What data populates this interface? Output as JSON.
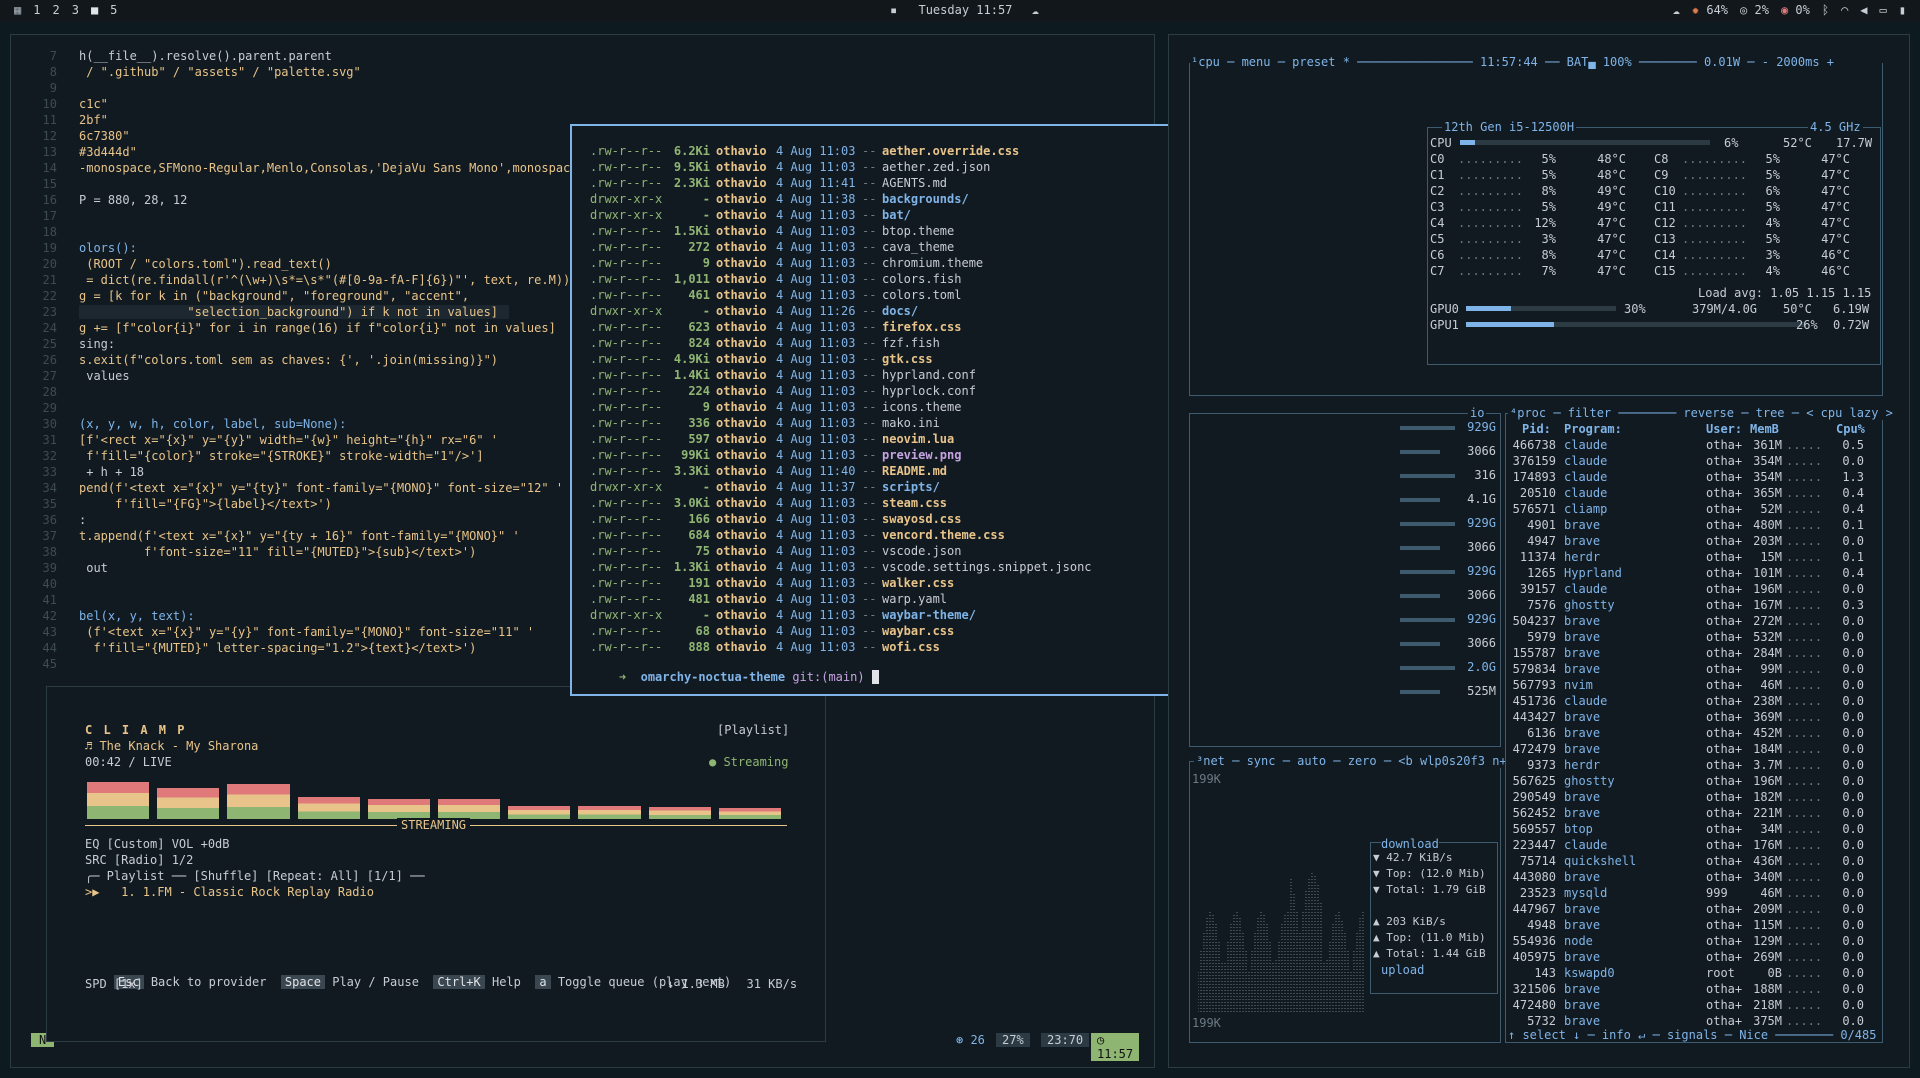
{
  "topbar": {
    "workspaces": [
      "1",
      "2",
      "3",
      "4",
      "5"
    ],
    "clock": "Tuesday 11:57",
    "cpu": "64%",
    "mem": "2%",
    "temp": "0%"
  },
  "editor": {
    "lines": [
      {
        "n": "7",
        "t": "h(__file__).resolve().parent.parent"
      },
      {
        "n": "8",
        "t": " / \".github\" / \"assets\" / \"palette.svg\""
      },
      {
        "n": "9",
        "t": ""
      },
      {
        "n": "10",
        "t": "c1c\""
      },
      {
        "n": "11",
        "t": "2bf\""
      },
      {
        "n": "12",
        "t": "6c7380\""
      },
      {
        "n": "13",
        "t": "#3d444d\""
      },
      {
        "n": "14",
        "t": "-monospace,SFMono-Regular,Menlo,Consolas,'DejaVu Sans Mono',monospace\""
      },
      {
        "n": "15",
        "t": ""
      },
      {
        "n": "16",
        "t": "P = 880, 28, 12"
      },
      {
        "n": "17",
        "t": ""
      },
      {
        "n": "18",
        "t": ""
      },
      {
        "n": "19",
        "t": "olors():"
      },
      {
        "n": "20",
        "t": " (ROOT / \"colors.toml\").read_text()"
      },
      {
        "n": "21",
        "t": " = dict(re.findall(r'^(\\w+)\\s*=\\s*\"(#[0-9a-fA-F]{6})\"', text, re.M))"
      },
      {
        "n": "22",
        "t": "g = [k for k in (\"background\", \"foreground\", \"accent\","
      },
      {
        "n": "23",
        "t": "               \"selection_background\") if k not in values]"
      },
      {
        "n": "24",
        "t": "g += [f\"color{i}\" for i in range(16) if f\"color{i}\" not in values]"
      },
      {
        "n": "25",
        "t": "sing:"
      },
      {
        "n": "26",
        "t": "s.exit(f\"colors.toml sem as chaves: {', '.join(missing)}\")"
      },
      {
        "n": "27",
        "t": " values"
      },
      {
        "n": "28",
        "t": ""
      },
      {
        "n": "29",
        "t": ""
      },
      {
        "n": "30",
        "t": "(x, y, w, h, color, label, sub=None):"
      },
      {
        "n": "31",
        "t": "[f'<rect x=\"{x}\" y=\"{y}\" width=\"{w}\" height=\"{h}\" rx=\"6\" '"
      },
      {
        "n": "32",
        "t": " f'fill=\"{color}\" stroke=\"{STROKE}\" stroke-width=\"1\"/>']"
      },
      {
        "n": "33",
        "t": " + h + 18"
      },
      {
        "n": "34",
        "t": "pend(f'<text x=\"{x}\" y=\"{ty}\" font-family=\"{MONO}\" font-size=\"12\" '"
      },
      {
        "n": "35",
        "t": "     f'fill=\"{FG}\">{label}</text>')"
      },
      {
        "n": "36",
        "t": ":"
      },
      {
        "n": "37",
        "t": "t.append(f'<text x=\"{x}\" y=\"{ty + 16}\" font-family=\"{MONO}\" '"
      },
      {
        "n": "38",
        "t": "         f'font-size=\"11\" fill=\"{MUTED}\">{sub}</text>')"
      },
      {
        "n": "39",
        "t": " out"
      },
      {
        "n": "40",
        "t": ""
      },
      {
        "n": "41",
        "t": ""
      },
      {
        "n": "42",
        "t": "bel(x, y, text):"
      },
      {
        "n": "43",
        "t": " (f'<text x=\"{x}\" y=\"{y}\" font-family=\"{MONO}\" font-size=\"11\" '"
      },
      {
        "n": "44",
        "t": "  f'fill=\"{MUTED}\" letter-spacing=\"1.2\">{text}</text>')"
      },
      {
        "n": "45",
        "t": ""
      }
    ],
    "status": {
      "mode": "N",
      "branch": "26",
      "pct": "27%",
      "pos": "23:70",
      "time": "11:57"
    }
  },
  "listing": {
    "entries": [
      {
        "p": ".rw-r--r--",
        "s": "6.2Ki",
        "u": "othavio",
        "d": "4 Aug 11:03",
        "n": "aether.override.css",
        "c": "yl"
      },
      {
        "p": ".rw-r--r--",
        "s": "9.5Ki",
        "u": "othavio",
        "d": "4 Aug 11:03",
        "n": "aether.zed.json",
        "c": ""
      },
      {
        "p": ".rw-r--r--",
        "s": "2.3Ki",
        "u": "othavio",
        "d": "4 Aug 11:41",
        "n": "AGENTS.md",
        "c": ""
      },
      {
        "p": "drwxr-xr-x",
        "s": "-",
        "u": "othavio",
        "d": "4 Aug 11:38",
        "n": "backgrounds/",
        "c": "bl"
      },
      {
        "p": "drwxr-xr-x",
        "s": "-",
        "u": "othavio",
        "d": "4 Aug 11:03",
        "n": "bat/",
        "c": "bl"
      },
      {
        "p": ".rw-r--r--",
        "s": "1.5Ki",
        "u": "othavio",
        "d": "4 Aug 11:03",
        "n": "btop.theme",
        "c": ""
      },
      {
        "p": ".rw-r--r--",
        "s": "272",
        "u": "othavio",
        "d": "4 Aug 11:03",
        "n": "cava_theme",
        "c": ""
      },
      {
        "p": ".rw-r--r--",
        "s": "9",
        "u": "othavio",
        "d": "4 Aug 11:03",
        "n": "chromium.theme",
        "c": ""
      },
      {
        "p": ".rw-r--r--",
        "s": "1,011",
        "u": "othavio",
        "d": "4 Aug 11:03",
        "n": "colors.fish",
        "c": ""
      },
      {
        "p": ".rw-r--r--",
        "s": "461",
        "u": "othavio",
        "d": "4 Aug 11:03",
        "n": "colors.toml",
        "c": ""
      },
      {
        "p": "drwxr-xr-x",
        "s": "-",
        "u": "othavio",
        "d": "4 Aug 11:26",
        "n": "docs/",
        "c": "bl"
      },
      {
        "p": ".rw-r--r--",
        "s": "623",
        "u": "othavio",
        "d": "4 Aug 11:03",
        "n": "firefox.css",
        "c": "yl"
      },
      {
        "p": ".rw-r--r--",
        "s": "824",
        "u": "othavio",
        "d": "4 Aug 11:03",
        "n": "fzf.fish",
        "c": ""
      },
      {
        "p": ".rw-r--r--",
        "s": "4.9Ki",
        "u": "othavio",
        "d": "4 Aug 11:03",
        "n": "gtk.css",
        "c": "yl"
      },
      {
        "p": ".rw-r--r--",
        "s": "1.4Ki",
        "u": "othavio",
        "d": "4 Aug 11:03",
        "n": "hyprland.conf",
        "c": ""
      },
      {
        "p": ".rw-r--r--",
        "s": "224",
        "u": "othavio",
        "d": "4 Aug 11:03",
        "n": "hyprlock.conf",
        "c": ""
      },
      {
        "p": ".rw-r--r--",
        "s": "9",
        "u": "othavio",
        "d": "4 Aug 11:03",
        "n": "icons.theme",
        "c": ""
      },
      {
        "p": ".rw-r--r--",
        "s": "336",
        "u": "othavio",
        "d": "4 Aug 11:03",
        "n": "mako.ini",
        "c": ""
      },
      {
        "p": ".rw-r--r--",
        "s": "597",
        "u": "othavio",
        "d": "4 Aug 11:03",
        "n": "neovim.lua",
        "c": "yl"
      },
      {
        "p": ".rw-r--r--",
        "s": "99Ki",
        "u": "othavio",
        "d": "4 Aug 11:03",
        "n": "preview.png",
        "c": "kw"
      },
      {
        "p": ".rw-r--r--",
        "s": "3.3Ki",
        "u": "othavio",
        "d": "4 Aug 11:40",
        "n": "README.md",
        "c": "yl"
      },
      {
        "p": "drwxr-xr-x",
        "s": "-",
        "u": "othavio",
        "d": "4 Aug 11:37",
        "n": "scripts/",
        "c": "bl"
      },
      {
        "p": ".rw-r--r--",
        "s": "3.0Ki",
        "u": "othavio",
        "d": "4 Aug 11:03",
        "n": "steam.css",
        "c": "yl"
      },
      {
        "p": ".rw-r--r--",
        "s": "166",
        "u": "othavio",
        "d": "4 Aug 11:03",
        "n": "swayosd.css",
        "c": "yl"
      },
      {
        "p": ".rw-r--r--",
        "s": "684",
        "u": "othavio",
        "d": "4 Aug 11:03",
        "n": "vencord.theme.css",
        "c": "yl"
      },
      {
        "p": ".rw-r--r--",
        "s": "75",
        "u": "othavio",
        "d": "4 Aug 11:03",
        "n": "vscode.json",
        "c": ""
      },
      {
        "p": ".rw-r--r--",
        "s": "1.3Ki",
        "u": "othavio",
        "d": "4 Aug 11:03",
        "n": "vscode.settings.snippet.jsonc",
        "c": ""
      },
      {
        "p": ".rw-r--r--",
        "s": "191",
        "u": "othavio",
        "d": "4 Aug 11:03",
        "n": "walker.css",
        "c": "yl"
      },
      {
        "p": ".rw-r--r--",
        "s": "481",
        "u": "othavio",
        "d": "4 Aug 11:03",
        "n": "warp.yaml",
        "c": ""
      },
      {
        "p": "drwxr-xr-x",
        "s": "-",
        "u": "othavio",
        "d": "4 Aug 11:03",
        "n": "waybar-theme/",
        "c": "bl"
      },
      {
        "p": ".rw-r--r--",
        "s": "68",
        "u": "othavio",
        "d": "4 Aug 11:03",
        "n": "waybar.css",
        "c": "yl"
      },
      {
        "p": ".rw-r--r--",
        "s": "888",
        "u": "othavio",
        "d": "4 Aug 11:03",
        "n": "wofi.css",
        "c": "yl"
      }
    ],
    "prompt_dir": "omarchy-noctua-theme",
    "prompt_git": "git:(main)"
  },
  "player": {
    "title": "C L I A M P",
    "mode": "[Playlist]",
    "track": "♬ The Knack - My Sharona",
    "time": "00:42 / LIVE",
    "status": "● Streaming",
    "bars": [
      0.85,
      0.7,
      0.8,
      0.5,
      0.45,
      0.45,
      0.3,
      0.3,
      0.28,
      0.25
    ],
    "streaming_label": "STREAMING",
    "eq": "EQ [Custom] VOL +0dB",
    "src": "SRC [Radio] 1/2",
    "playlist_header": "╭─ Playlist ── [Shuffle] [Repeat: All] [1/1] ──",
    "playlist_item": ">▶   1. 1.FM - Classic Rock Replay Radio",
    "keys": [
      {
        "k": "Esc",
        "l": "Back to provider"
      },
      {
        "k": "Space",
        "l": "Play / Pause"
      },
      {
        "k": "Ctrl+K",
        "l": "Help"
      },
      {
        "k": "a",
        "l": "Toggle queue (play next)"
      }
    ],
    "spd": "SPD [1x]",
    "dl": "↓ 1.3 MB   31 KB/s"
  },
  "btop": {
    "header": "¹cpu ─ menu ─ preset * ──────────────── 11:57:44 ── BAT▄ 100% ──────── 0.01W ─ - 2000ms +",
    "cpu_model": "12th Gen i5-12500H",
    "cpu_freq": "4.5 GHz",
    "cpu_total": {
      "label": "CPU",
      "pct": "6%",
      "temp": "52°C",
      "pow": "17.7W",
      "val": 0.06
    },
    "cores": [
      {
        "l": "C0",
        "p": "5%",
        "t": "48°C"
      },
      {
        "l": "C8",
        "p": "5%",
        "t": "47°C"
      },
      {
        "l": "C1",
        "p": "5%",
        "t": "48°C"
      },
      {
        "l": "C9",
        "p": "5%",
        "t": "47°C"
      },
      {
        "l": "C2",
        "p": "8%",
        "t": "49°C"
      },
      {
        "l": "C10",
        "p": "6%",
        "t": "47°C"
      },
      {
        "l": "C3",
        "p": "5%",
        "t": "49°C"
      },
      {
        "l": "C11",
        "p": "5%",
        "t": "47°C"
      },
      {
        "l": "C4",
        "p": "12%",
        "t": "47°C"
      },
      {
        "l": "C12",
        "p": "4%",
        "t": "47°C"
      },
      {
        "l": "C5",
        "p": "3%",
        "t": "47°C"
      },
      {
        "l": "C13",
        "p": "5%",
        "t": "47°C"
      },
      {
        "l": "C6",
        "p": "8%",
        "t": "47°C"
      },
      {
        "l": "C14",
        "p": "3%",
        "t": "46°C"
      },
      {
        "l": "C7",
        "p": "7%",
        "t": "47°C"
      },
      {
        "l": "C15",
        "p": "4%",
        "t": "46°C"
      }
    ],
    "load": "Load avg: 1.05 1.15 1.15",
    "gpu0": {
      "l": "GPU0",
      "p": "30%",
      "mem": "379M/4.0G",
      "t": "50°C",
      "w": "6.19W",
      "val": 0.3
    },
    "gpu1": {
      "l": "GPU1",
      "p": "26%",
      "w": "0.72W",
      "val": 0.26
    },
    "io_label": "io",
    "io_vals": [
      "929G",
      "3066",
      "316",
      "4.1G",
      "929G",
      "3066",
      "929G",
      "3066",
      "929G",
      "3066",
      "2.0G",
      "525M"
    ],
    "net_header": "³net ─ sync ─ auto ─ zero ─ <b wlp0s20f3 n+",
    "net_top": "199K",
    "net_bottom": "199K",
    "download": {
      "label": "download",
      "rate": "▼ 42.7 KiB/s",
      "top": "▼ Top: (12.0 Mib)",
      "total": "▼ Total: 1.79 GiB"
    },
    "upload": {
      "label": "upload",
      "rate": "▲ 203 KiB/s",
      "top": "▲ Top: (11.0 Mib)",
      "total": "▲ Total: 1.44 GiB"
    },
    "proc_header": "⁴proc ─ filter ──────── reverse ─ tree ─ < cpu lazy >",
    "proc_cols": {
      "pid": "Pid:",
      "prog": "Program:",
      "user": "User:",
      "mem": "MemB",
      "cpu": "Cpu%"
    },
    "procs": [
      [
        "466738",
        "claude",
        "otha+",
        "361M",
        "0.5"
      ],
      [
        "376159",
        "claude",
        "otha+",
        "354M",
        "0.0"
      ],
      [
        "174893",
        "claude",
        "otha+",
        "354M",
        "1.3"
      ],
      [
        "20510",
        "claude",
        "otha+",
        "365M",
        "0.4"
      ],
      [
        "576571",
        "cliamp",
        "otha+",
        "52M",
        "0.4"
      ],
      [
        "4901",
        "brave",
        "otha+",
        "480M",
        "0.1"
      ],
      [
        "4947",
        "brave",
        "otha+",
        "203M",
        "0.0"
      ],
      [
        "11374",
        "herdr",
        "otha+",
        "15M",
        "0.1"
      ],
      [
        "1265",
        "Hyprland",
        "otha+",
        "101M",
        "0.4"
      ],
      [
        "39157",
        "claude",
        "otha+",
        "196M",
        "0.0"
      ],
      [
        "7576",
        "ghostty",
        "otha+",
        "167M",
        "0.3"
      ],
      [
        "504237",
        "brave",
        "otha+",
        "272M",
        "0.0"
      ],
      [
        "5979",
        "brave",
        "otha+",
        "532M",
        "0.0"
      ],
      [
        "155787",
        "brave",
        "otha+",
        "284M",
        "0.0"
      ],
      [
        "579834",
        "brave",
        "otha+",
        "99M",
        "0.0"
      ],
      [
        "567793",
        "nvim",
        "otha+",
        "46M",
        "0.0"
      ],
      [
        "451736",
        "claude",
        "otha+",
        "238M",
        "0.0"
      ],
      [
        "443427",
        "brave",
        "otha+",
        "369M",
        "0.0"
      ],
      [
        "6136",
        "brave",
        "otha+",
        "452M",
        "0.0"
      ],
      [
        "472479",
        "brave",
        "otha+",
        "184M",
        "0.0"
      ],
      [
        "9373",
        "herdr",
        "otha+",
        "3.7M",
        "0.0"
      ],
      [
        "567625",
        "ghostty",
        "otha+",
        "196M",
        "0.0"
      ],
      [
        "290549",
        "brave",
        "otha+",
        "182M",
        "0.0"
      ],
      [
        "562452",
        "brave",
        "otha+",
        "221M",
        "0.0"
      ],
      [
        "569557",
        "btop",
        "otha+",
        "34M",
        "0.0"
      ],
      [
        "223447",
        "claude",
        "otha+",
        "176M",
        "0.0"
      ],
      [
        "75714",
        "quickshell",
        "otha+",
        "436M",
        "0.0"
      ],
      [
        "443080",
        "brave",
        "otha+",
        "340M",
        "0.0"
      ],
      [
        "23523",
        "mysqld",
        "999",
        "46M",
        "0.0"
      ],
      [
        "447967",
        "brave",
        "otha+",
        "209M",
        "0.0"
      ],
      [
        "4948",
        "brave",
        "otha+",
        "115M",
        "0.0"
      ],
      [
        "554936",
        "node",
        "otha+",
        "129M",
        "0.0"
      ],
      [
        "405975",
        "brave",
        "otha+",
        "269M",
        "0.0"
      ],
      [
        "143",
        "kswapd0",
        "root",
        "0B",
        "0.0"
      ],
      [
        "321506",
        "brave",
        "otha+",
        "188M",
        "0.0"
      ],
      [
        "472480",
        "brave",
        "otha+",
        "218M",
        "0.0"
      ],
      [
        "5732",
        "brave",
        "otha+",
        "375M",
        "0.0"
      ]
    ],
    "proc_footer": "↑ select ↓ ─ info ↵ ─ signals ─ Nice ──────── 0/485"
  }
}
